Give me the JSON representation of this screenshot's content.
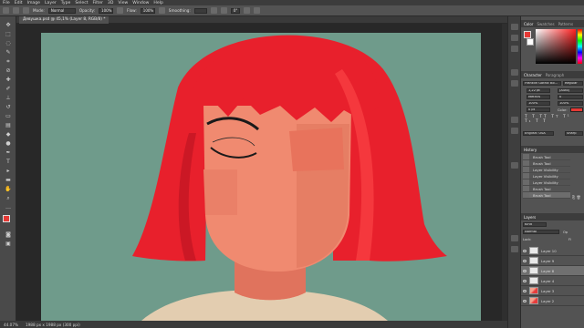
{
  "menu": [
    "File",
    "Edit",
    "Image",
    "Layer",
    "Type",
    "Select",
    "Filter",
    "3D",
    "View",
    "Window",
    "Help"
  ],
  "options": {
    "mode_label": "Mode:",
    "mode_value": "Normal",
    "opacity_label": "Opacity:",
    "opacity_value": "100%",
    "flow_label": "Flow:",
    "flow_value": "100%",
    "smoothing_label": "Smoothing:",
    "smoothing_value": "",
    "angle_value": "0°"
  },
  "document_tab": "Девушка.psd @ 45,1% (Layer 8, RGB/8) *",
  "status": {
    "zoom": "44.07%",
    "doc_size": "1988 px x 1988 px (300 ppi)"
  },
  "panels": {
    "color_tabs": [
      "Color",
      "Swatches",
      "Patterns"
    ],
    "character_tabs": [
      "Character",
      "Paragraph"
    ],
    "font_family": "Franklin Gothic Bo...",
    "font_style": "Regular",
    "font_size": "1,22 pt",
    "leading": "(Auto)",
    "kerning": "Metrics",
    "tracking": "0",
    "vscale": "100%",
    "hscale": "100%",
    "baseline": "0 pt",
    "color_label": "Color:",
    "language": "English: USA",
    "aa": "Sharp",
    "history_title": "History",
    "history": [
      "Brush Tool",
      "Brush Tool",
      "Layer Visibility",
      "Layer Visibility",
      "Layer Visibility",
      "Brush Tool",
      "Brush Tool"
    ],
    "layers_title": "Layers",
    "layers_filter": "Kind",
    "blend_mode": "Normal",
    "opacity_short": "Op",
    "lock_label": "Lock:",
    "fill_label": "Fi",
    "layers": [
      "Layer 10",
      "Layer 9",
      "Layer 8",
      "Layer 4",
      "Layer 3",
      "Layer 2"
    ]
  },
  "colors": {
    "canvas_bg": "#6f9b8b",
    "hair": "#e8202c",
    "skin": "#f08a70",
    "shirt": "#e3cdb0",
    "foreground_swatch": "#e53935"
  }
}
